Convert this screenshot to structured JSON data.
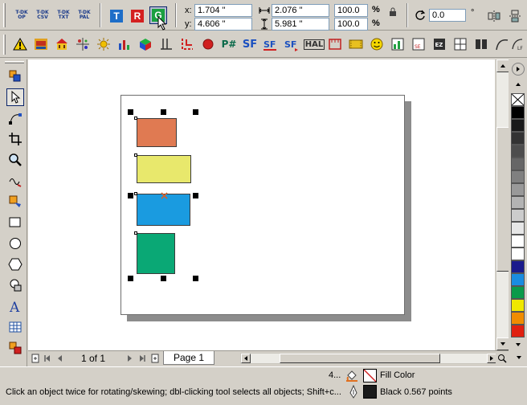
{
  "toolbar_top": {
    "mini_labels": [
      "T-DK\nOP",
      "T-DK\nCSV",
      "T-DK\nTXT",
      "T-DK\nPAL"
    ],
    "text_buttons": [
      "T",
      "R",
      "G"
    ],
    "x_label": "x:",
    "x_value": "1.704 \"",
    "y_label": "y:",
    "y_value": "4.606 \"",
    "width_value": "2.076 \"",
    "height_value": "5.981 \"",
    "scale_x": "100.0",
    "scale_y": "100.0",
    "percent": "%",
    "angle_value": "0.0",
    "degree": "°"
  },
  "toolbar_second": {
    "hash_label": "P#",
    "sf_label": "SF",
    "hal_label": "HAL"
  },
  "statusbar": {
    "hint": "Click an object twice for rotating/skewing; dbl-clicking tool selects all objects; Shift+c...",
    "count": "4...",
    "fill_label": "Fill Color",
    "outline_label": "Black  0.567 points"
  },
  "pager": {
    "page_count": "1 of 1",
    "page_tab": "Page 1"
  },
  "colors": {
    "orange": "#e07a52",
    "yellow": "#e8e86c",
    "blue": "#1a9be0",
    "green": "#0aa875"
  }
}
